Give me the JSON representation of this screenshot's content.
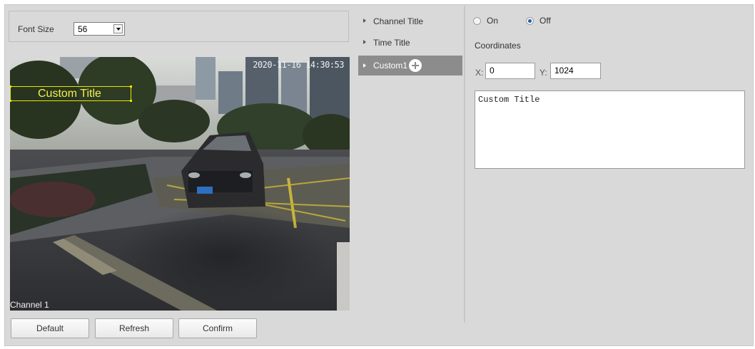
{
  "font_size": {
    "label": "Font Size",
    "value": "56"
  },
  "preview": {
    "timestamp": "2020-11-16 14:30:53",
    "channel_label": "Channel 1",
    "custom_overlay_text": "Custom Title"
  },
  "buttons": {
    "default": "Default",
    "refresh": "Refresh",
    "confirm": "Confirm"
  },
  "tree": [
    {
      "label": "Channel Title",
      "selected": false
    },
    {
      "label": "Time Title",
      "selected": false
    },
    {
      "label": "Custom1",
      "selected": true
    }
  ],
  "display": {
    "on_label": "On",
    "off_label": "Off",
    "selected": "Off"
  },
  "coordinates": {
    "label": "Coordinates",
    "x_label": "X:",
    "x_value": "0",
    "y_label": "Y:",
    "y_value": "1024"
  },
  "custom_text": "Custom Title",
  "colors": {
    "selected_bg": "#8c8c8c",
    "overlay_yellow": "#e6e600",
    "panel_bg": "#d9d9d9"
  }
}
